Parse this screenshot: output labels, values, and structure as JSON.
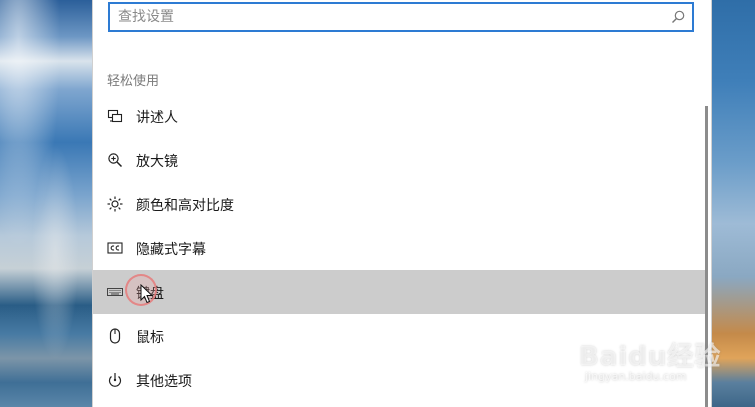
{
  "search": {
    "placeholder": "查找设置"
  },
  "section": {
    "title": "轻松使用"
  },
  "nav": {
    "items": [
      {
        "label": "讲述人",
        "icon": "narrator-icon"
      },
      {
        "label": "放大镜",
        "icon": "magnifier-icon"
      },
      {
        "label": "颜色和高对比度",
        "icon": "brightness-icon"
      },
      {
        "label": "隐藏式字幕",
        "icon": "closed-captions-icon"
      },
      {
        "label": "键盘",
        "icon": "keyboard-icon",
        "selected": true
      },
      {
        "label": "鼠标",
        "icon": "mouse-icon"
      },
      {
        "label": "其他选项",
        "icon": "other-options-icon"
      }
    ]
  },
  "colors": {
    "accent": "#2d7bd3",
    "selected_bg": "#cccccc"
  },
  "watermark": {
    "logo": "Baidu经验",
    "url": "jingyan.baidu.com"
  }
}
